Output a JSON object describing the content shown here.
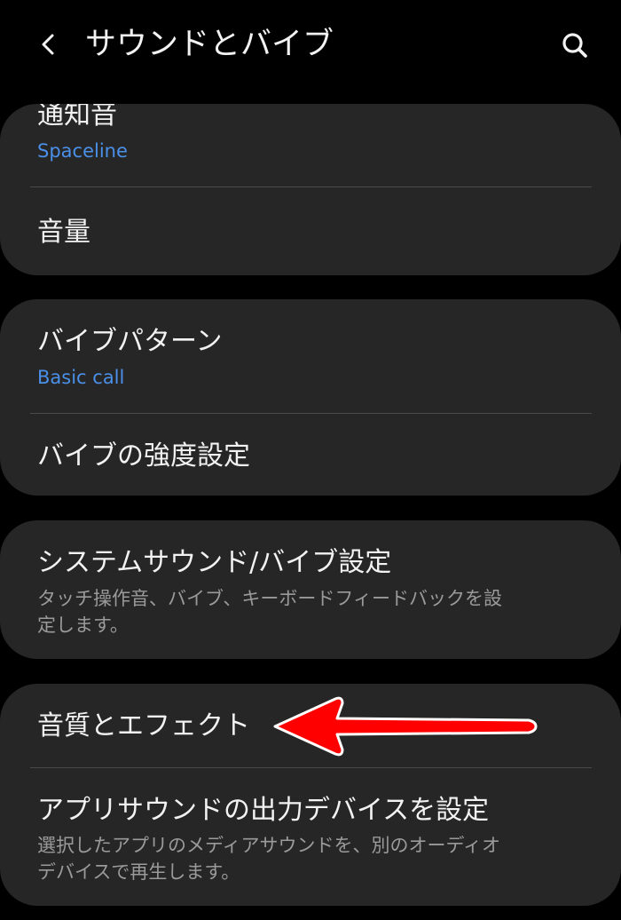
{
  "header": {
    "title": "サウンドとバイブ",
    "back_icon": "chevron-left-icon",
    "search_icon": "search-icon"
  },
  "cards": {
    "sound": {
      "ringtone": {
        "label": "通知音",
        "value": "Spaceline"
      },
      "volume": {
        "label": "音量"
      }
    },
    "vibration": {
      "pattern": {
        "label": "バイブパターン",
        "value": "Basic call"
      },
      "intensity": {
        "label": "バイブの強度設定"
      }
    },
    "system": {
      "system_sound": {
        "label": "システムサウンド/バイブ設定",
        "desc_line1": "タッチ操作音、バイブ、キーボードフィードバックを設",
        "desc_line2": "定します。"
      }
    },
    "quality": {
      "effects": {
        "label": "音質とエフェクト"
      },
      "app_output": {
        "label": "アプリサウンドの出力デバイスを設定",
        "desc_line1": "選択したアプリのメディアサウンドを、別のオーディオ",
        "desc_line2": "デバイスで再生します。"
      }
    }
  },
  "annotation": {
    "arrow_color": "#ff0000",
    "arrow_icon": "red-arrow-annotation"
  },
  "colors": {
    "background": "#000000",
    "card": "#262626",
    "accent_blue": "#4a8fe8",
    "text_primary": "#f2f2f2",
    "text_secondary": "#9a9a9a"
  }
}
